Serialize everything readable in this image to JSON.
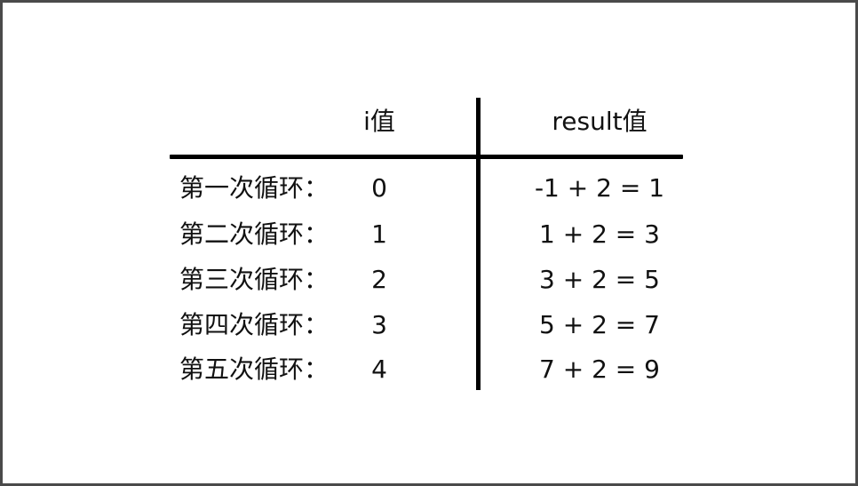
{
  "header": {
    "i_col": "i值",
    "result_col": "result值"
  },
  "rows": [
    {
      "label": "第一次循环：",
      "i": "0",
      "result": "-1 + 2 = 1"
    },
    {
      "label": "第二次循环：",
      "i": "1",
      "result": "1 + 2 = 3"
    },
    {
      "label": "第三次循环：",
      "i": "2",
      "result": "3 + 2 = 5"
    },
    {
      "label": "第四次循环：",
      "i": "3",
      "result": "5 + 2 = 7"
    },
    {
      "label": "第五次循环：",
      "i": "4",
      "result": "7 + 2 = 9"
    }
  ]
}
